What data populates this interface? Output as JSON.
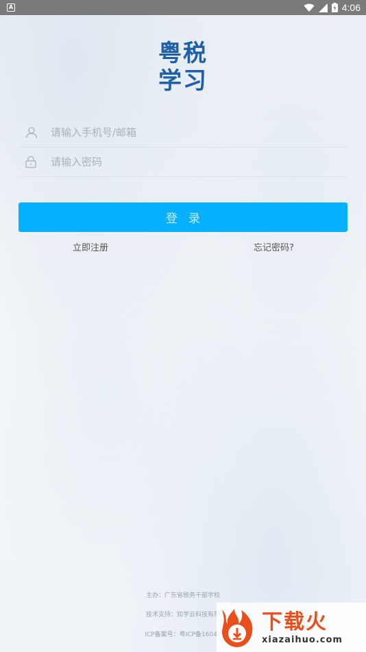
{
  "status_bar": {
    "time": "4:06",
    "notif_glyph": "A"
  },
  "logo": {
    "line1": "粤税",
    "line2": "学习"
  },
  "login_form": {
    "username_placeholder": "请输入手机号/邮箱",
    "password_placeholder": "请输入密码",
    "login_label": "登录",
    "register_label": "立即注册",
    "forgot_label": "忘记密码?"
  },
  "footer": {
    "host": "主办：广东省税务干部学校",
    "support": "技术支持：知学云科技有限",
    "icp": "ICP备案号：粤ICP备16047"
  },
  "watermark": {
    "cn": "下载火",
    "en": "xiazaihuo.com"
  },
  "colors": {
    "brand_blue": "#1f5fa8",
    "button_blue": "#07b0ff",
    "watermark_orange": "#e94f1d"
  }
}
